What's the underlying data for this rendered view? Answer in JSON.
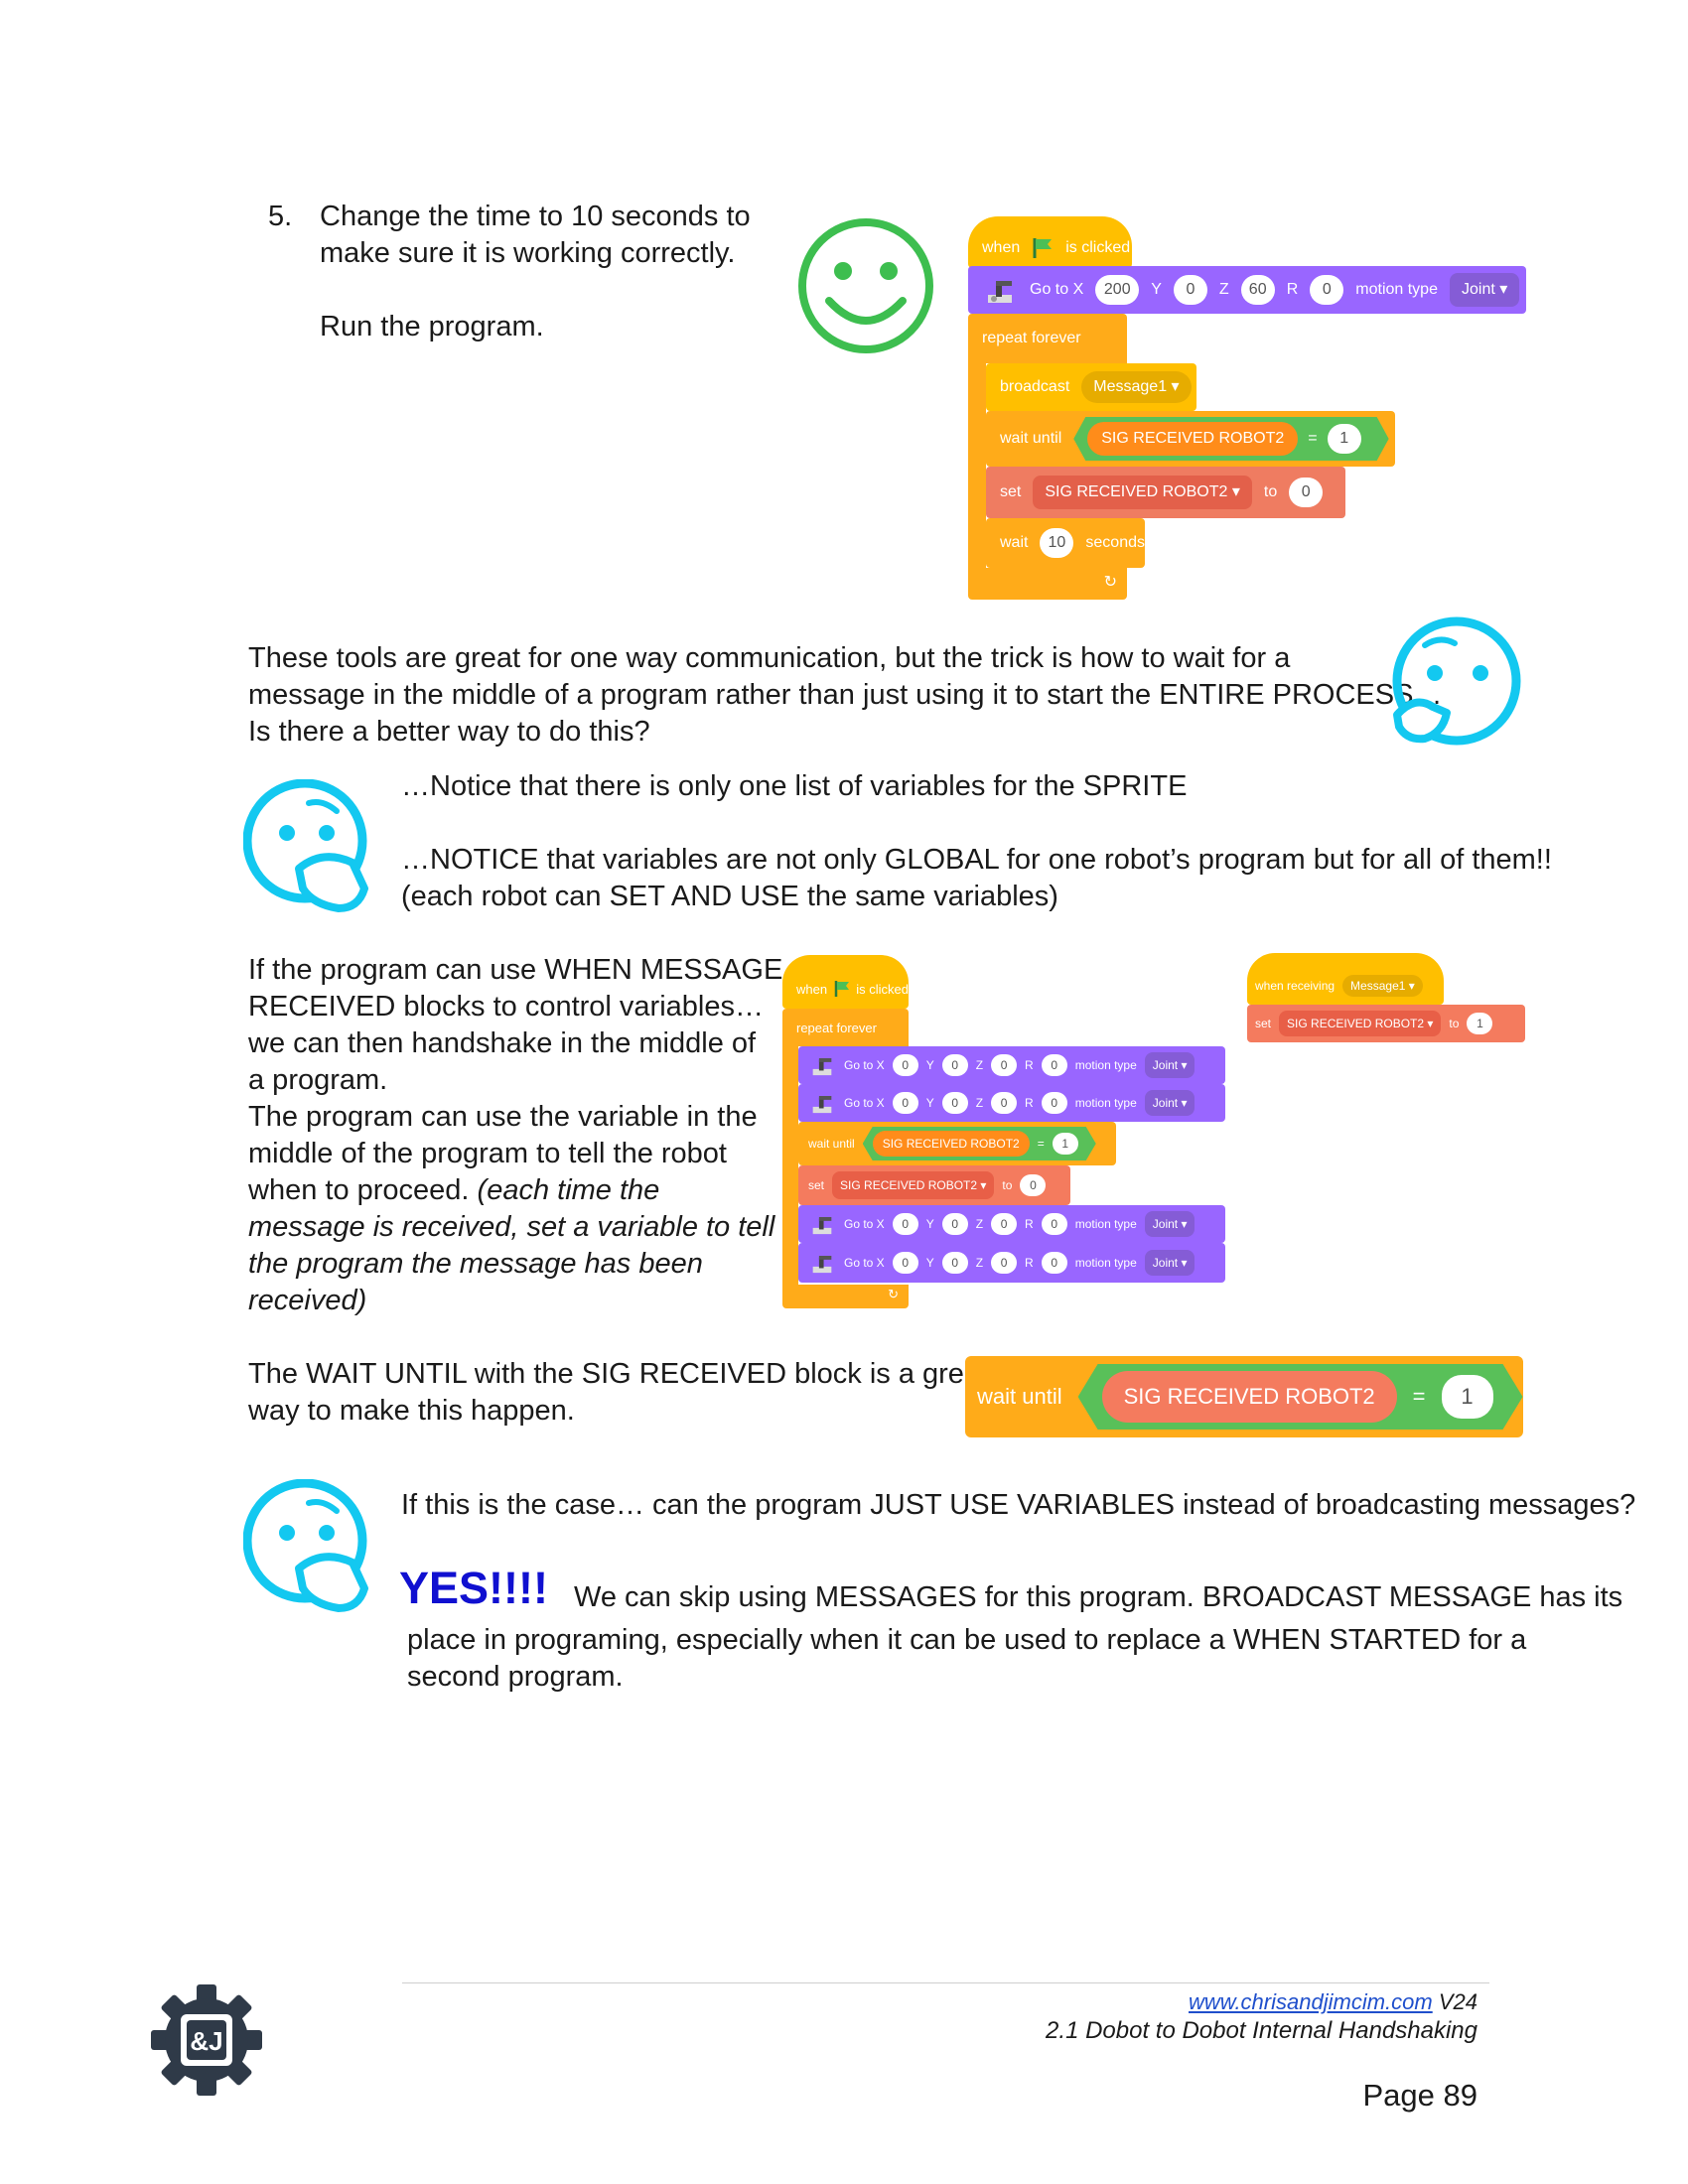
{
  "step5": {
    "number": "5.",
    "line1": "Change the time to 10 seconds to",
    "line2": "make sure it is working correctly.",
    "run": "Run the program."
  },
  "block1": {
    "when": "when",
    "is_clicked": "is clicked",
    "goto_x": "Go to X",
    "x": "200",
    "y_label": "Y",
    "y": "0",
    "z_label": "Z",
    "z": "60",
    "r_label": "R",
    "r": "0",
    "motion_type": "motion type",
    "joint": "Joint",
    "repeat_forever": "repeat forever",
    "broadcast": "broadcast",
    "message1": "Message1",
    "wait_until": "wait until",
    "sig": "SIG RECEIVED ROBOT2",
    "eq": "=",
    "one": "1",
    "set": "set",
    "to": "to",
    "zero": "0",
    "wait": "wait",
    "ten": "10",
    "seconds": "seconds"
  },
  "para1": {
    "line1": "These tools are great for one way communication, but the trick is how to wait for a",
    "line2": "message in the middle of a program rather than just using it to start the ENTIRE PROCESS…",
    "line3": "Is there a better way to do this?"
  },
  "notice": {
    "line1": "…Notice that there is only one list of variables for the SPRITE",
    "line2": "…NOTICE that variables are not only GLOBAL for one robot’s program but for all of them!!",
    "line3": "(each robot can SET AND USE the same variables)"
  },
  "para2": {
    "l1": "If the program can use WHEN MESSAGE",
    "l2": "RECEIVED blocks to control variables…",
    "l3": "we can then handshake in the middle of",
    "l4": "a program.",
    "l5": "The program can use the variable in the",
    "l6": "middle of the program to tell the robot",
    "l7a": "when to proceed.",
    "l7b": "(each time the",
    "l8": "message is received, set a variable to tell",
    "l9": "the program the message has been",
    "l10": "received)"
  },
  "block2": {
    "when": "when",
    "is_clicked": "is clicked",
    "repeat_forever": "repeat forever",
    "goto_x": "Go to X",
    "zero": "0",
    "y_label": "Y",
    "z_label": "Z",
    "r_label": "R",
    "motion_type": "motion type",
    "joint": "Joint",
    "wait_until": "wait until",
    "sig": "SIG RECEIVED ROBOT2",
    "eq": "=",
    "one": "1",
    "set": "set",
    "to": "to"
  },
  "block3": {
    "when_receiving": "when receiving",
    "message1": "Message1",
    "set": "set",
    "sig": "SIG RECEIVED ROBOT2",
    "to": "to",
    "one": "1"
  },
  "para3": {
    "line1": "The WAIT UNTIL with the SIG RECEIVED block is a great",
    "line2": "way to make this happen."
  },
  "block4": {
    "wait_until": "wait until",
    "sig": "SIG RECEIVED ROBOT2",
    "eq": "=",
    "one": "1"
  },
  "para4": {
    "question": "If this is the case… can the program JUST USE VARIABLES instead of broadcasting messages?",
    "yes": "YES!!!!",
    "line1": "We can skip using MESSAGES for this program. BROADCAST MESSAGE has its",
    "line2": "place in programing, especially when it can be used to replace a WHEN STARTED for a",
    "line3": "second program."
  },
  "footer": {
    "url": "www.chrisandjimcim.com",
    "version": "V24",
    "subtitle": "2.1 Dobot to Dobot Internal Handshaking",
    "page": "Page 89",
    "logo_text": "&J"
  },
  "colors": {
    "events": "#FFBF00",
    "control": "#FFAB19",
    "motion": "#9966FF",
    "operator": "#59C059",
    "variable": "#FF8C1A",
    "data_set": "#FF6680",
    "smiley": "#3DBE4F",
    "thinking": "#13C8F0",
    "yes": "#1010D0"
  }
}
